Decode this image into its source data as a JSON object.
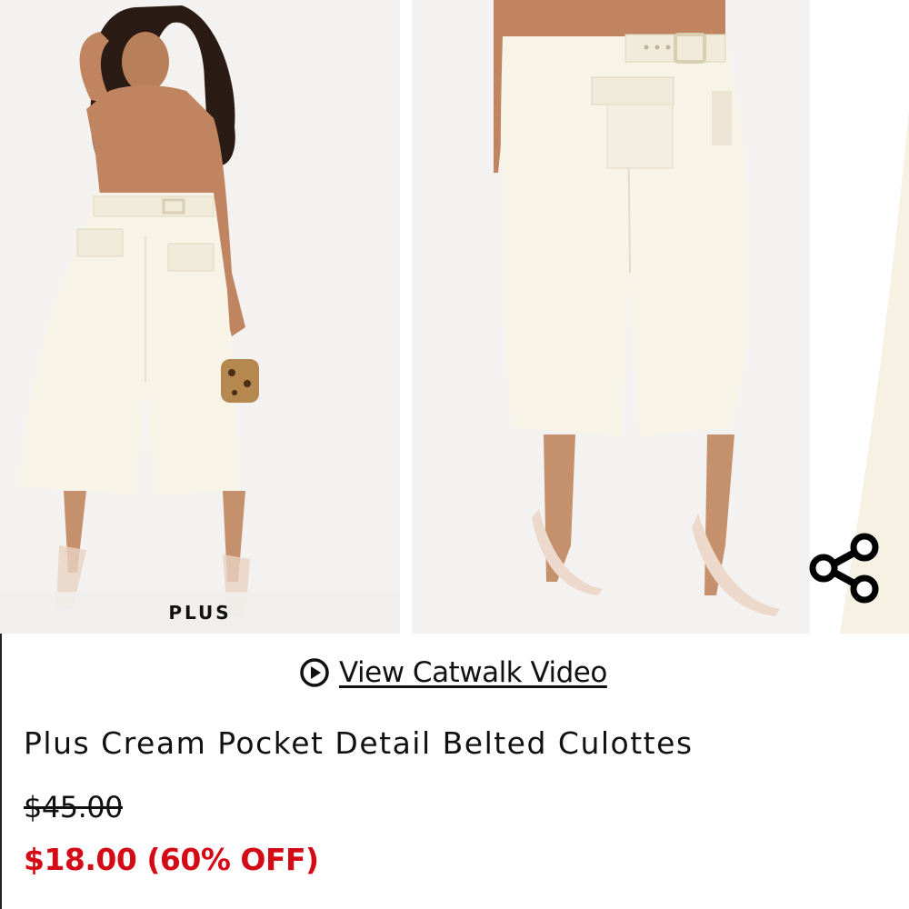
{
  "gallery": {
    "badge_label": "PLUS",
    "share_icon": "share-icon"
  },
  "video_link": {
    "icon": "play-circle-icon",
    "label": "View Catwalk Video"
  },
  "product": {
    "title": "Plus Cream Pocket Detail Belted Culottes",
    "original_price": "$45.00",
    "sale_price": "$18.00 (60% OFF)"
  },
  "colors": {
    "sale_red": "#d40b16",
    "text": "#111111",
    "garment_cream": "#f6f1e1",
    "top_tan": "#c08560"
  }
}
